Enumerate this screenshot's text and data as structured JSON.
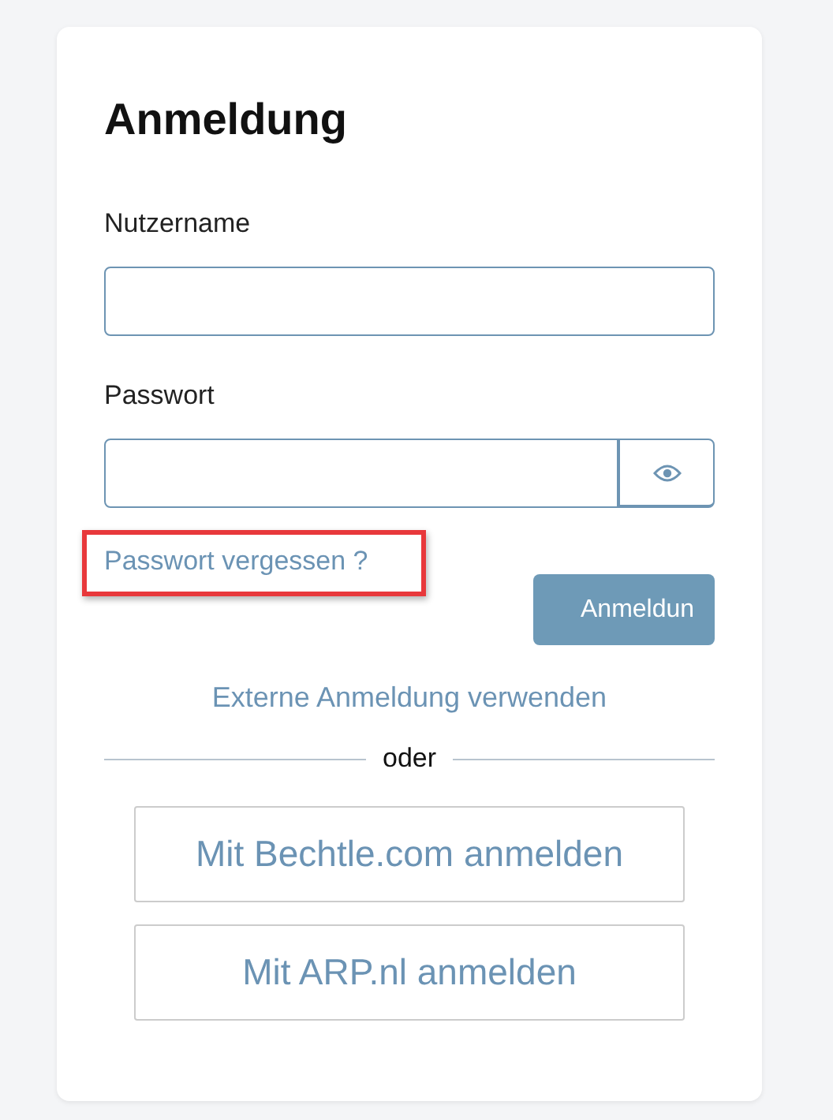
{
  "title": "Anmeldung",
  "fields": [
    {
      "label": "Nutzername",
      "kind": "text"
    },
    {
      "label": "Passwort",
      "kind": "password"
    }
  ],
  "forgot_link": {
    "text": "Passwort vergessen ?",
    "highlighted": true
  },
  "submit_button": {
    "label": "Anmeldun"
  },
  "external_link": "Externe Anmeldung verwenden",
  "divider_text": "oder",
  "providers": [
    {
      "label": "Mit Bechtle.com anmelden"
    },
    {
      "label": "Mit ARP.nl anmelden"
    }
  ]
}
